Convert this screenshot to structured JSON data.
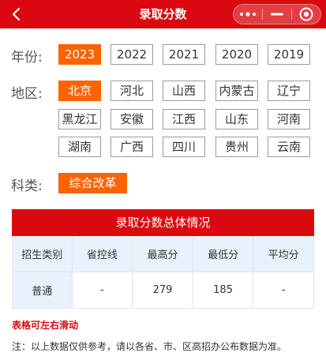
{
  "header": {
    "title": "录取分数",
    "back_icon": "chevron-left-icon",
    "capsule_icons": [
      "more-dots-icon",
      "minimize-icon",
      "close-target-icon"
    ]
  },
  "filters": {
    "year": {
      "label": "年份:",
      "options": [
        "2023",
        "2022",
        "2021",
        "2020",
        "2019"
      ],
      "selected": "2023"
    },
    "region": {
      "label": "地区:",
      "options": [
        "北京",
        "河北",
        "山西",
        "内蒙古",
        "辽宁",
        "黑龙江",
        "安徽",
        "江西",
        "山东",
        "河南",
        "湖南",
        "广西",
        "四川",
        "贵州",
        "云南"
      ],
      "selected": "北京"
    },
    "subject": {
      "label": "科类:",
      "options": [
        "综合改革"
      ],
      "selected": "综合改革"
    }
  },
  "table": {
    "title": "录取分数总体情况",
    "headers": [
      "招生类别",
      "省控线",
      "最高分",
      "最低分",
      "平均分"
    ],
    "rows": [
      [
        "普通",
        "-",
        "279",
        "185",
        "-"
      ]
    ]
  },
  "swipe_hint": "表格可左右滑动",
  "note": "注：以上数据仅供参考，请以各省、市、区高招办公布数据为准。",
  "colors": {
    "primary_red": "#d9090f",
    "active_orange": "#ff6200",
    "header_cell_bg": "#e8f2fc"
  }
}
